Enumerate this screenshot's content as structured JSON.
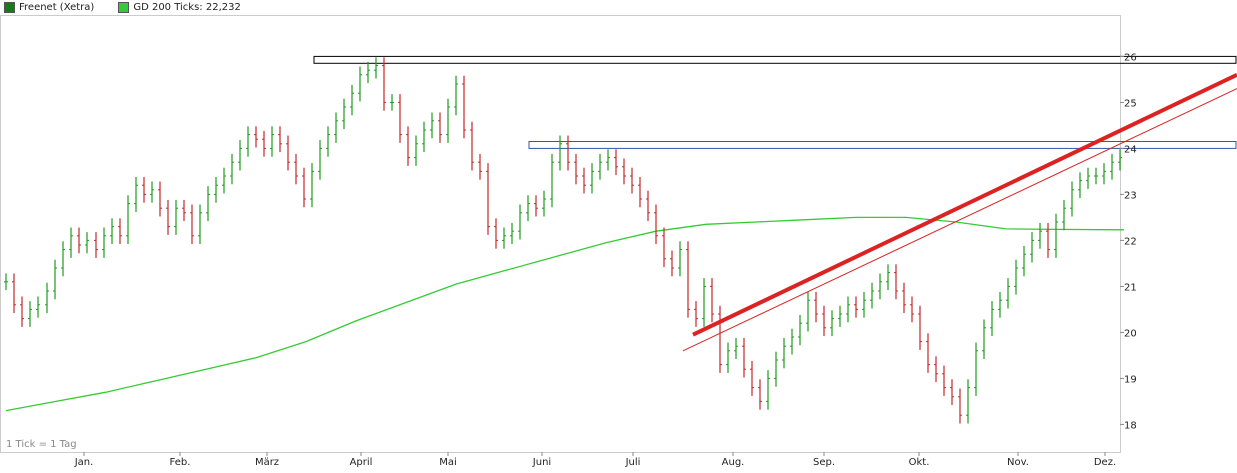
{
  "chart_data": {
    "type": "line",
    "legend": [
      {
        "label": "Freenet (Xetra)",
        "color": "#1a7a1a"
      },
      {
        "label": "GD 200 Ticks: 22,232",
        "color": "#33cc33"
      }
    ],
    "footnote": "1 Tick = 1 Tag",
    "x_categories": [
      "Jan.",
      "Feb.",
      "März",
      "April",
      "Mai",
      "Juni",
      "Juli",
      "Aug.",
      "Sep.",
      "Okt.",
      "Nov.",
      "Dez."
    ],
    "y_ticks": [
      "18",
      "19",
      "20",
      "21",
      "22",
      "23",
      "24",
      "25",
      "26"
    ],
    "ylim": [
      17.4,
      26.9
    ],
    "grid": false,
    "colors": {
      "up": "#1e9b1e",
      "down": "#c0282a",
      "ma": "#33cc33",
      "trend": "#dd2222",
      "box_black": "#000000",
      "box_blue": "#3355aa"
    },
    "series": [
      {
        "name": "Freenet (Xetra)",
        "x": [
          0,
          8,
          16,
          24,
          32,
          41,
          49,
          57,
          65,
          73,
          81,
          90,
          98,
          106,
          114,
          122,
          130,
          138,
          146,
          154,
          162,
          170,
          178,
          186,
          194,
          202,
          210,
          218,
          226,
          234,
          242,
          250,
          258,
          266,
          274,
          282,
          290,
          298,
          306,
          314,
          322,
          330,
          338,
          346,
          354,
          362,
          370,
          378,
          386,
          394,
          402,
          410,
          418,
          426,
          434,
          442,
          450,
          458,
          466,
          474,
          482,
          490,
          498,
          506,
          514,
          522,
          530,
          538,
          546,
          554,
          562,
          570,
          578,
          586,
          594,
          602,
          610,
          618,
          626,
          634,
          642,
          650,
          658,
          666,
          674,
          682,
          690,
          698,
          706,
          714,
          722,
          730,
          738,
          746,
          754,
          762,
          770,
          778,
          786,
          794,
          802,
          810,
          818,
          826,
          834,
          842,
          850,
          858,
          866,
          874,
          882,
          890,
          898,
          906,
          914,
          922,
          930,
          938,
          946,
          954,
          962,
          970,
          978,
          986,
          994,
          1002,
          1010,
          1018,
          1026,
          1034,
          1042,
          1050,
          1058,
          1066,
          1074,
          1082,
          1090,
          1098,
          1106,
          1114
        ],
        "values": [
          21.1,
          20.6,
          20.3,
          20.5,
          20.6,
          20.9,
          21.4,
          21.8,
          22.1,
          21.9,
          22.0,
          21.8,
          22.1,
          22.3,
          22.1,
          22.8,
          23.2,
          23.0,
          23.1,
          22.7,
          22.3,
          22.7,
          22.6,
          22.1,
          22.6,
          23.0,
          23.2,
          23.4,
          23.7,
          24.0,
          24.3,
          24.2,
          24.0,
          24.3,
          24.1,
          23.7,
          23.4,
          22.9,
          23.5,
          24.0,
          24.3,
          24.6,
          24.9,
          25.2,
          25.6,
          25.7,
          25.8,
          25.0,
          25.0,
          24.3,
          23.8,
          24.1,
          24.4,
          24.6,
          24.3,
          24.9,
          25.4,
          24.4,
          23.7,
          23.5,
          22.3,
          22.0,
          22.1,
          22.2,
          22.6,
          22.8,
          22.7,
          22.9,
          23.7,
          24.1,
          23.7,
          23.4,
          23.2,
          23.5,
          23.7,
          23.8,
          23.6,
          23.4,
          23.2,
          22.9,
          22.6,
          22.1,
          21.6,
          21.4,
          21.8,
          20.5,
          20.3,
          21.0,
          20.4,
          19.3,
          19.6,
          19.7,
          19.2,
          18.8,
          18.5,
          19.0,
          19.4,
          19.7,
          19.9,
          20.2,
          20.7,
          20.4,
          20.1,
          20.3,
          20.4,
          20.6,
          20.5,
          20.7,
          20.9,
          21.1,
          21.3,
          20.9,
          20.6,
          20.4,
          19.8,
          19.3,
          19.1,
          18.8,
          18.6,
          18.2,
          18.8,
          19.6,
          20.1,
          20.5,
          20.7,
          21.0,
          21.4,
          21.7,
          22.0,
          22.2,
          21.8,
          22.4,
          22.7,
          23.1,
          23.3,
          23.4,
          23.4,
          23.5,
          23.7,
          23.8
        ]
      },
      {
        "name": "GD 200 Ticks: 22,232",
        "x": [
          0,
          50,
          100,
          150,
          200,
          250,
          300,
          350,
          400,
          450,
          500,
          550,
          600,
          650,
          700,
          750,
          800,
          850,
          900,
          950,
          1000,
          1050,
          1118
        ],
        "values": [
          18.3,
          18.5,
          18.7,
          18.95,
          19.2,
          19.45,
          19.8,
          20.25,
          20.65,
          21.05,
          21.35,
          21.65,
          21.95,
          22.2,
          22.35,
          22.4,
          22.45,
          22.5,
          22.5,
          22.4,
          22.25,
          22.24,
          22.23
        ]
      }
    ],
    "annotations": {
      "resistance_zones": [
        {
          "x_start": 314,
          "x_end": 1237,
          "y_top": 26.0,
          "y_bottom": 25.85,
          "color": "box_black"
        },
        {
          "x_start": 529,
          "x_end": 1237,
          "y_top": 24.15,
          "y_bottom": 24.0,
          "color": "box_blue"
        }
      ],
      "trend_lines": [
        {
          "x1": 693,
          "y1": 19.95,
          "x2": 1237,
          "y2": 25.6,
          "width": 4
        },
        {
          "x1": 683,
          "y1": 19.6,
          "x2": 1237,
          "y2": 25.3,
          "width": 1
        }
      ]
    }
  }
}
